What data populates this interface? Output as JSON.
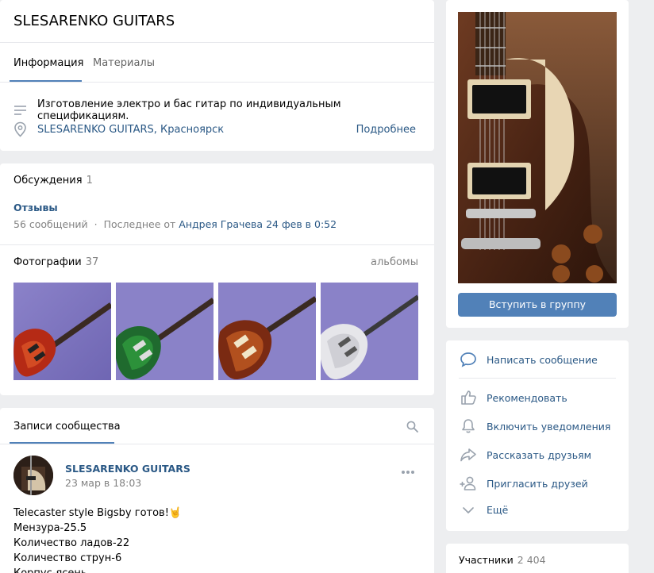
{
  "header": {
    "title": "SLESARENKO GUITARS",
    "tabs": [
      {
        "label": "Информация",
        "active": true
      },
      {
        "label": "Материалы",
        "active": false
      }
    ],
    "description": "Изготовление электро и бас гитар по индивидуальным спецификациям.",
    "location": "SLESARENKO GUITARS, Красноярск",
    "more_link": "Подробнее"
  },
  "discussions": {
    "title": "Обсуждения",
    "count": "1",
    "topic": {
      "title": "Отзывы",
      "messages": "56 сообщений",
      "separator": "·",
      "last_prefix": "Последнее от",
      "last_author": "Андрея Грачева",
      "last_date": "24 фев в 0:52"
    }
  },
  "photos": {
    "title": "Фотографии",
    "count": "37",
    "albums_link": "альбомы",
    "items": [
      "red-headless-guitar-photo",
      "green-lespaul-photo",
      "sunburst-guitar-photo",
      "white-guitar-photo"
    ]
  },
  "wall": {
    "tab": "Записи сообщества",
    "post": {
      "author": "SLESARENKO GUITARS",
      "date": "23 мар в 18:03",
      "lines": [
        "Telecaster style Bigsby готов!🤘",
        "Мензура-25.5",
        "Количество ладов-22",
        "Количество струн-6",
        "Корпус-ясень"
      ]
    }
  },
  "sidebar": {
    "join_button": "Вступить в группу",
    "actions": [
      {
        "label": "Написать сообщение",
        "icon": "message-icon"
      },
      {
        "label": "Рекомендовать",
        "icon": "like-icon"
      },
      {
        "label": "Включить уведомления",
        "icon": "bell-icon"
      },
      {
        "label": "Рассказать друзьям",
        "icon": "share-icon"
      },
      {
        "label": "Пригласить друзей",
        "icon": "add-user-icon"
      },
      {
        "label": "Ещё",
        "icon": "chevron-down-icon"
      }
    ],
    "members_title": "Участники",
    "members_count": "2 404"
  },
  "colors": {
    "link": "#2a5885",
    "accent": "#5181b8",
    "background": "#edeef0"
  }
}
